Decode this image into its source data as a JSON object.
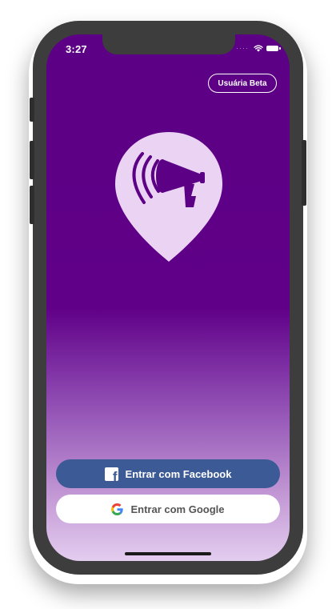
{
  "status_bar": {
    "time": "3:27"
  },
  "header": {
    "beta_button_label": "Usuária Beta"
  },
  "logo": {
    "icon": "megaphone-pin-icon"
  },
  "auth": {
    "facebook_label": "Entrar com Facebook",
    "google_label": "Entrar com Google"
  },
  "colors": {
    "background_top": "#5c0085",
    "background_bottom": "#e3cdef",
    "facebook_blue": "#3c5a96",
    "logo_fill": "#ead3f3"
  }
}
